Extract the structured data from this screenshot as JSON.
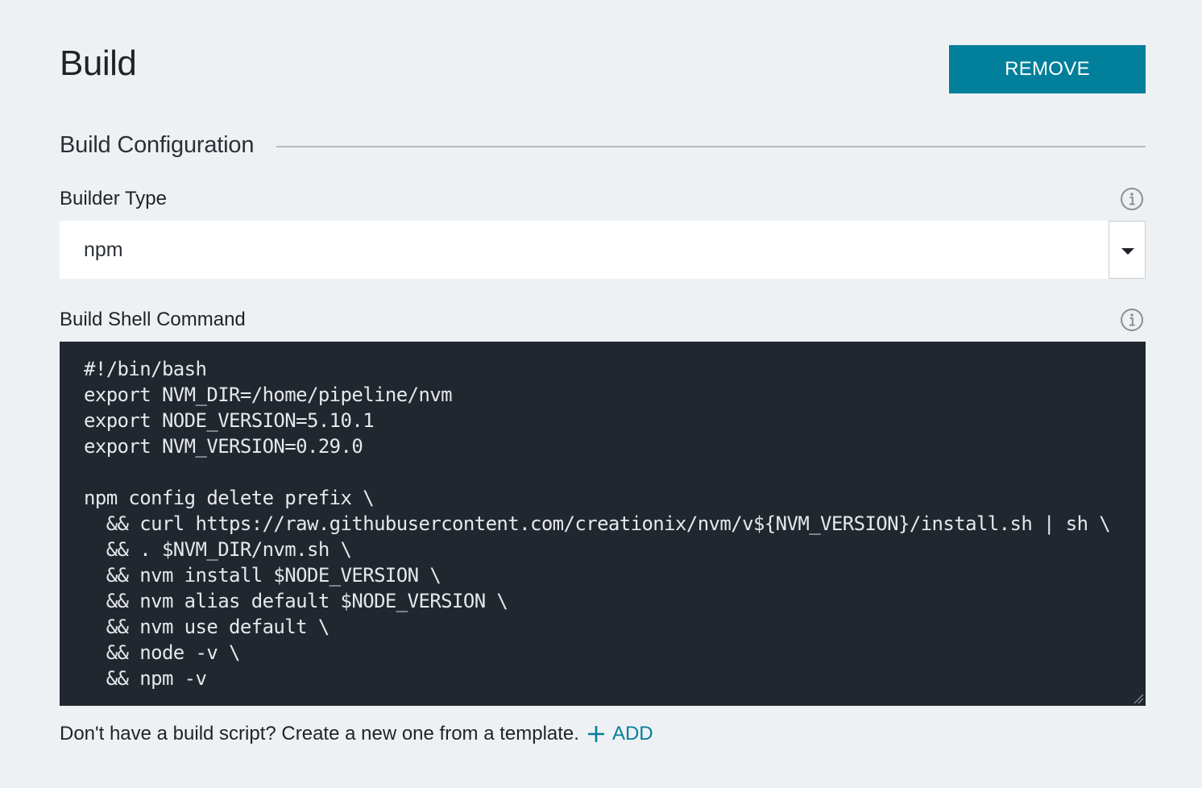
{
  "header": {
    "title": "Build",
    "remove_label": "REMOVE"
  },
  "section": {
    "title": "Build Configuration"
  },
  "builder_type": {
    "label": "Builder Type",
    "value": "npm",
    "info_icon": "info-icon"
  },
  "shell_command": {
    "label": "Build Shell Command",
    "info_icon": "info-icon",
    "lines": [
      "#!/bin/bash",
      "export NVM_DIR=/home/pipeline/nvm",
      "export NODE_VERSION=5.10.1",
      "export NVM_VERSION=0.29.0",
      "",
      "npm config delete prefix \\",
      "  && curl https://raw.githubusercontent.com/creationix/nvm/v${NVM_VERSION}/install.sh | sh \\",
      "  && . $NVM_DIR/nvm.sh \\",
      "  && nvm install $NODE_VERSION \\",
      "  && nvm alias default $NODE_VERSION \\",
      "  && nvm use default \\",
      "  && node -v \\",
      "  && npm -v"
    ]
  },
  "footer": {
    "text": "Don't have a build script? Create a new one from a template.",
    "add_label": "ADD",
    "add_icon": "plus-icon"
  },
  "colors": {
    "accent": "#027f9b",
    "background": "#eef1f4",
    "code_background": "#20272f"
  }
}
